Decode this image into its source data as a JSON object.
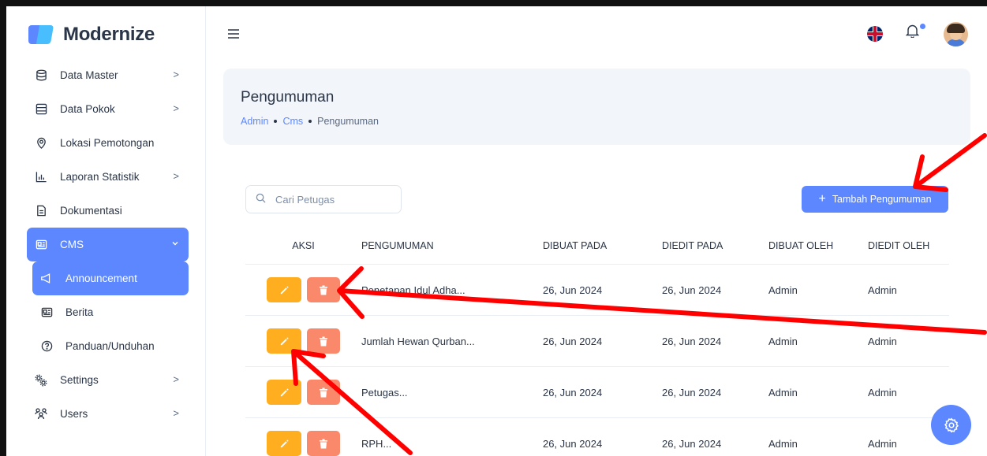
{
  "app": {
    "name": "Modernize"
  },
  "sidebar": {
    "items": [
      {
        "label": "Data Master",
        "icon": "database-icon",
        "chevron": ">"
      },
      {
        "label": "Data Pokok",
        "icon": "table-icon",
        "chevron": ">"
      },
      {
        "label": "Lokasi Pemotongan",
        "icon": "map-pin-icon"
      },
      {
        "label": "Laporan Statistik",
        "icon": "chart-bar-icon",
        "chevron": ">"
      },
      {
        "label": "Dokumentasi",
        "icon": "file-icon"
      },
      {
        "label": "CMS",
        "icon": "cms-icon",
        "chevron": "v",
        "active": true
      },
      {
        "label": "Announcement",
        "icon": "megaphone-icon",
        "active": true
      },
      {
        "label": "Berita",
        "icon": "news-icon"
      },
      {
        "label": "Panduan/Unduhan",
        "icon": "help-circle-icon"
      },
      {
        "label": "Settings",
        "icon": "settings-icon",
        "chevron": ">"
      },
      {
        "label": "Users",
        "icon": "users-icon",
        "chevron": ">"
      }
    ]
  },
  "header": {
    "language": "EN",
    "notification_dot": true
  },
  "page": {
    "title": "Pengumuman",
    "breadcrumb": [
      "Admin",
      "Cms",
      "Pengumuman"
    ]
  },
  "search": {
    "placeholder": "Cari Petugas",
    "value": ""
  },
  "add_button": {
    "label": "Tambah Pengumuman"
  },
  "table": {
    "columns": [
      "AKSI",
      "PENGUMUMAN",
      "DIBUAT PADA",
      "DIEDIT PADA",
      "DIBUAT OLEH",
      "DIEDIT OLEH"
    ],
    "rows": [
      {
        "title": "Penetapan Idul Adha...",
        "created": "26, Jun 2024",
        "edited": "26, Jun 2024",
        "created_by": "Admin",
        "edited_by": "Admin"
      },
      {
        "title": "Jumlah Hewan Qurban...",
        "created": "26, Jun 2024",
        "edited": "26, Jun 2024",
        "created_by": "Admin",
        "edited_by": "Admin"
      },
      {
        "title": "Petugas...",
        "created": "26, Jun 2024",
        "edited": "26, Jun 2024",
        "created_by": "Admin",
        "edited_by": "Admin"
      },
      {
        "title": "RPH...",
        "created": "26, Jun 2024",
        "edited": "26, Jun 2024",
        "created_by": "Admin",
        "edited_by": "Admin"
      }
    ]
  },
  "colors": {
    "primary": "#5d87ff",
    "warning": "#ffae1f",
    "danger": "#fa896b",
    "annotation": "#ff0000"
  }
}
